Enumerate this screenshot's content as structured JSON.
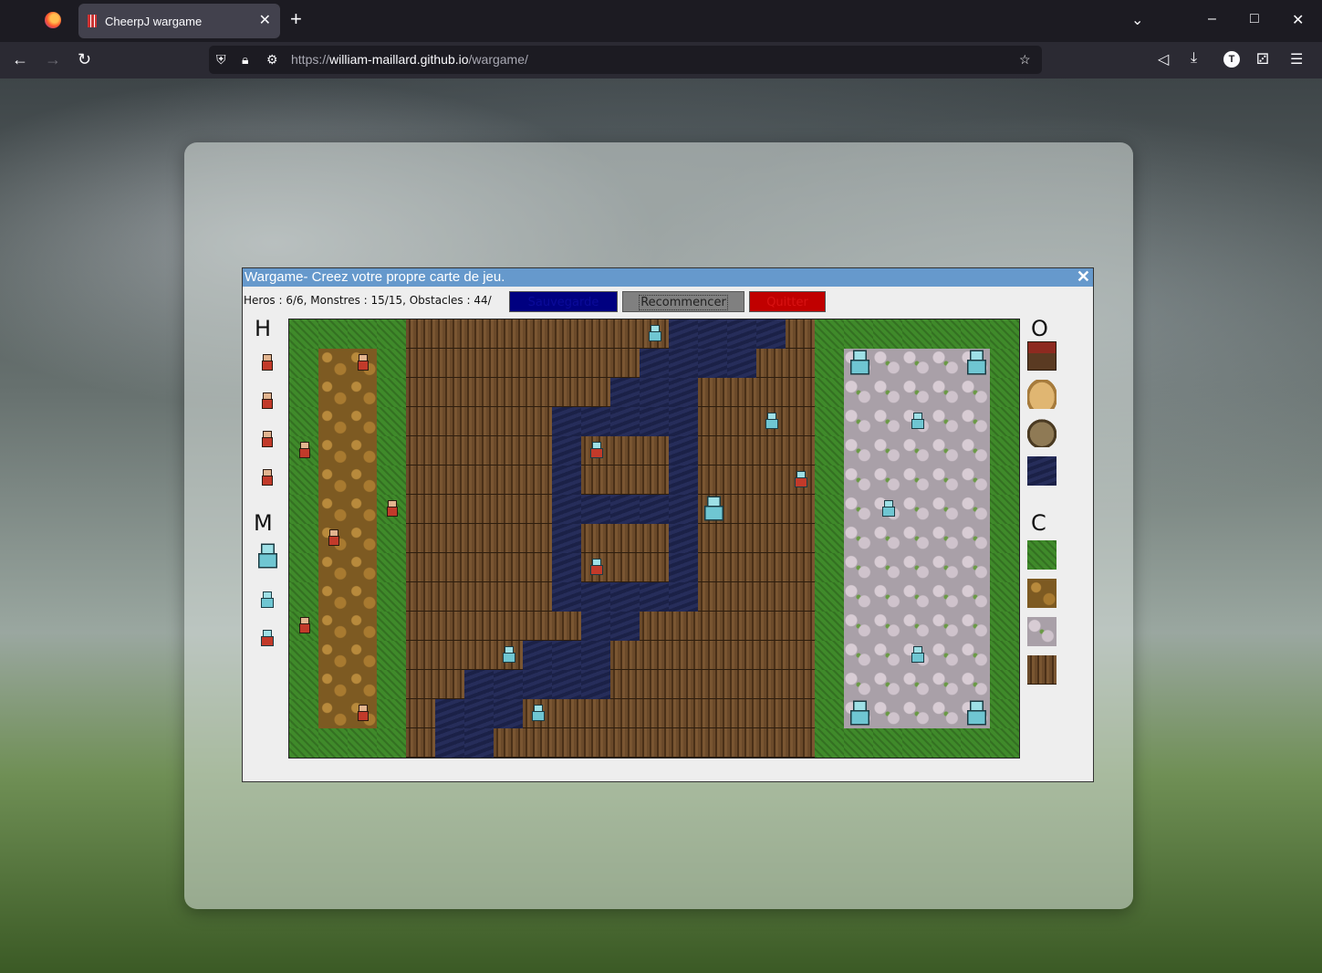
{
  "browser": {
    "tab_title": "CheerpJ wargame",
    "tab_close": "✕",
    "new_tab": "+",
    "url_protocol": "https://",
    "url_host": "william-maillard.github.io",
    "url_path": "/wargame/",
    "avatar_letter": "T"
  },
  "app": {
    "title": "Wargame- Creez votre propre carte de jeu.",
    "close": "✕",
    "status": "Heros : 6/6, Monstres : 15/15, Obstacles : 44/",
    "buttons": {
      "save": "Sauvegarde",
      "restart": "Recommencer",
      "quit": "Quitter"
    },
    "sections": {
      "heroes": "H",
      "monsters": "M",
      "obstacles": "O",
      "terrain": "C"
    },
    "obstacle_palette": [
      "chest-icon",
      "sack-icon",
      "rock-icon",
      "water-tile"
    ],
    "terrain_palette": [
      "grass-tile",
      "dirt-tile",
      "stone-tile",
      "wood-tile"
    ],
    "colors": {
      "title_bar": "#6699cc",
      "save_button": "#000080",
      "restart_button": "#808080",
      "quit_button": "#c00000"
    }
  }
}
